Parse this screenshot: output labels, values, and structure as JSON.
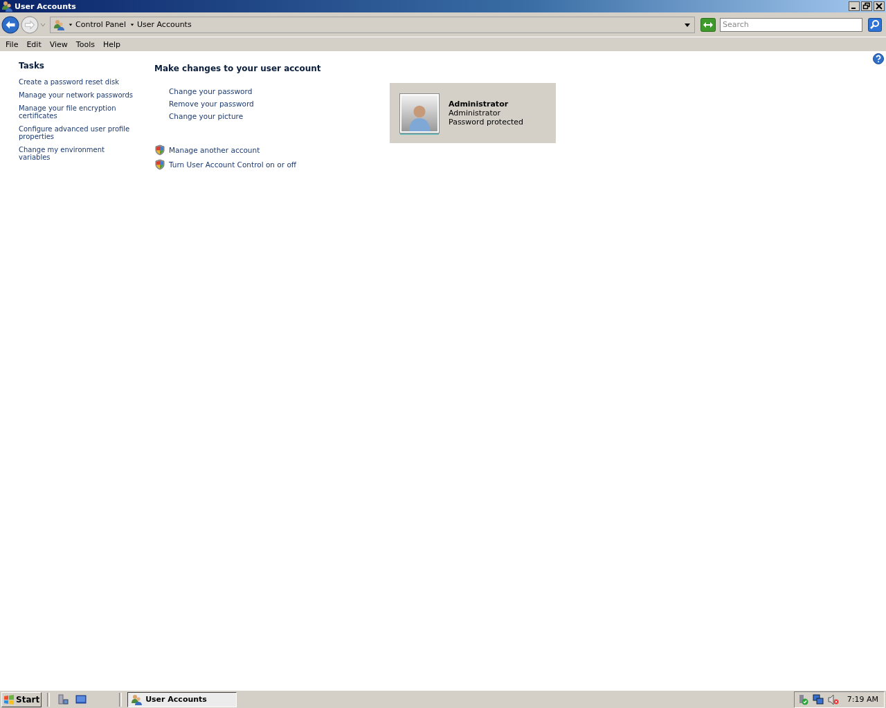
{
  "window": {
    "title": "User Accounts"
  },
  "address_bar": {
    "breadcrumbs": [
      "Control Panel",
      "User Accounts"
    ],
    "search": {
      "placeholder": "Search"
    }
  },
  "menu_bar": [
    "File",
    "Edit",
    "View",
    "Tools",
    "Help"
  ],
  "tasks": {
    "title": "Tasks",
    "links": [
      "Create a password reset disk",
      "Manage your network passwords",
      "Manage your file encryption certificates",
      "Configure advanced user profile properties",
      "Change my environment variables"
    ]
  },
  "main": {
    "heading": "Make changes to your user account",
    "links": [
      {
        "label": "Change your password",
        "kind": "plain"
      },
      {
        "label": "Remove your password",
        "kind": "plain"
      },
      {
        "label": "Change your picture",
        "kind": "plain"
      },
      {
        "label": "Manage another account",
        "kind": "shield"
      },
      {
        "label": "Turn User Account Control on or off",
        "kind": "shield"
      }
    ]
  },
  "account": {
    "name": "Administrator",
    "type": "Administrator",
    "status": "Password protected"
  },
  "taskbar": {
    "start": "Start",
    "windows": [
      {
        "label": "User Accounts",
        "selected": true
      }
    ],
    "clock": "7:19 AM"
  }
}
